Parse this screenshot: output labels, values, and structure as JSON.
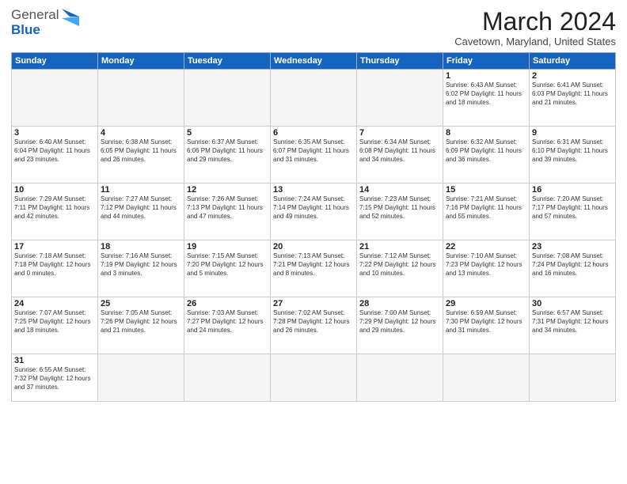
{
  "header": {
    "logo_general": "General",
    "logo_blue": "Blue",
    "month_title": "March 2024",
    "subtitle": "Cavetown, Maryland, United States"
  },
  "days_of_week": [
    "Sunday",
    "Monday",
    "Tuesday",
    "Wednesday",
    "Thursday",
    "Friday",
    "Saturday"
  ],
  "weeks": [
    [
      {
        "day": "",
        "info": ""
      },
      {
        "day": "",
        "info": ""
      },
      {
        "day": "",
        "info": ""
      },
      {
        "day": "",
        "info": ""
      },
      {
        "day": "",
        "info": ""
      },
      {
        "day": "1",
        "info": "Sunrise: 6:43 AM\nSunset: 6:02 PM\nDaylight: 11 hours and 18 minutes."
      },
      {
        "day": "2",
        "info": "Sunrise: 6:41 AM\nSunset: 6:03 PM\nDaylight: 11 hours and 21 minutes."
      }
    ],
    [
      {
        "day": "3",
        "info": "Sunrise: 6:40 AM\nSunset: 6:04 PM\nDaylight: 11 hours and 23 minutes."
      },
      {
        "day": "4",
        "info": "Sunrise: 6:38 AM\nSunset: 6:05 PM\nDaylight: 11 hours and 26 minutes."
      },
      {
        "day": "5",
        "info": "Sunrise: 6:37 AM\nSunset: 6:06 PM\nDaylight: 11 hours and 29 minutes."
      },
      {
        "day": "6",
        "info": "Sunrise: 6:35 AM\nSunset: 6:07 PM\nDaylight: 11 hours and 31 minutes."
      },
      {
        "day": "7",
        "info": "Sunrise: 6:34 AM\nSunset: 6:08 PM\nDaylight: 11 hours and 34 minutes."
      },
      {
        "day": "8",
        "info": "Sunrise: 6:32 AM\nSunset: 6:09 PM\nDaylight: 11 hours and 36 minutes."
      },
      {
        "day": "9",
        "info": "Sunrise: 6:31 AM\nSunset: 6:10 PM\nDaylight: 11 hours and 39 minutes."
      }
    ],
    [
      {
        "day": "10",
        "info": "Sunrise: 7:29 AM\nSunset: 7:11 PM\nDaylight: 11 hours and 42 minutes."
      },
      {
        "day": "11",
        "info": "Sunrise: 7:27 AM\nSunset: 7:12 PM\nDaylight: 11 hours and 44 minutes."
      },
      {
        "day": "12",
        "info": "Sunrise: 7:26 AM\nSunset: 7:13 PM\nDaylight: 11 hours and 47 minutes."
      },
      {
        "day": "13",
        "info": "Sunrise: 7:24 AM\nSunset: 7:14 PM\nDaylight: 11 hours and 49 minutes."
      },
      {
        "day": "14",
        "info": "Sunrise: 7:23 AM\nSunset: 7:15 PM\nDaylight: 11 hours and 52 minutes."
      },
      {
        "day": "15",
        "info": "Sunrise: 7:21 AM\nSunset: 7:16 PM\nDaylight: 11 hours and 55 minutes."
      },
      {
        "day": "16",
        "info": "Sunrise: 7:20 AM\nSunset: 7:17 PM\nDaylight: 11 hours and 57 minutes."
      }
    ],
    [
      {
        "day": "17",
        "info": "Sunrise: 7:18 AM\nSunset: 7:18 PM\nDaylight: 12 hours and 0 minutes."
      },
      {
        "day": "18",
        "info": "Sunrise: 7:16 AM\nSunset: 7:19 PM\nDaylight: 12 hours and 3 minutes."
      },
      {
        "day": "19",
        "info": "Sunrise: 7:15 AM\nSunset: 7:20 PM\nDaylight: 12 hours and 5 minutes."
      },
      {
        "day": "20",
        "info": "Sunrise: 7:13 AM\nSunset: 7:21 PM\nDaylight: 12 hours and 8 minutes."
      },
      {
        "day": "21",
        "info": "Sunrise: 7:12 AM\nSunset: 7:22 PM\nDaylight: 12 hours and 10 minutes."
      },
      {
        "day": "22",
        "info": "Sunrise: 7:10 AM\nSunset: 7:23 PM\nDaylight: 12 hours and 13 minutes."
      },
      {
        "day": "23",
        "info": "Sunrise: 7:08 AM\nSunset: 7:24 PM\nDaylight: 12 hours and 16 minutes."
      }
    ],
    [
      {
        "day": "24",
        "info": "Sunrise: 7:07 AM\nSunset: 7:25 PM\nDaylight: 12 hours and 18 minutes."
      },
      {
        "day": "25",
        "info": "Sunrise: 7:05 AM\nSunset: 7:26 PM\nDaylight: 12 hours and 21 minutes."
      },
      {
        "day": "26",
        "info": "Sunrise: 7:03 AM\nSunset: 7:27 PM\nDaylight: 12 hours and 24 minutes."
      },
      {
        "day": "27",
        "info": "Sunrise: 7:02 AM\nSunset: 7:28 PM\nDaylight: 12 hours and 26 minutes."
      },
      {
        "day": "28",
        "info": "Sunrise: 7:00 AM\nSunset: 7:29 PM\nDaylight: 12 hours and 29 minutes."
      },
      {
        "day": "29",
        "info": "Sunrise: 6:59 AM\nSunset: 7:30 PM\nDaylight: 12 hours and 31 minutes."
      },
      {
        "day": "30",
        "info": "Sunrise: 6:57 AM\nSunset: 7:31 PM\nDaylight: 12 hours and 34 minutes."
      }
    ],
    [
      {
        "day": "31",
        "info": "Sunrise: 6:55 AM\nSunset: 7:32 PM\nDaylight: 12 hours and 37 minutes."
      },
      {
        "day": "",
        "info": ""
      },
      {
        "day": "",
        "info": ""
      },
      {
        "day": "",
        "info": ""
      },
      {
        "day": "",
        "info": ""
      },
      {
        "day": "",
        "info": ""
      },
      {
        "day": "",
        "info": ""
      }
    ]
  ]
}
